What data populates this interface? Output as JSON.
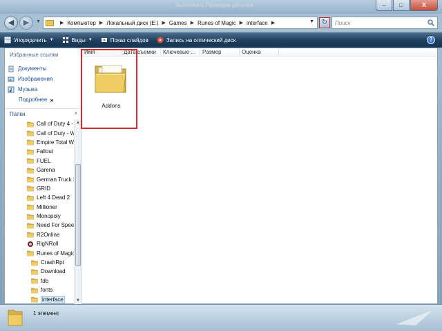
{
  "window": {
    "ghost_title": "Выполнить Проверка деталей"
  },
  "controls": {
    "minimize": "–",
    "maximize": "□",
    "close": "X"
  },
  "breadcrumbs": [
    {
      "label": "Компьютер"
    },
    {
      "label": "Локальный диск (E:)"
    },
    {
      "label": "Games"
    },
    {
      "label": "Runes of Magic"
    },
    {
      "label": "interface"
    }
  ],
  "search": {
    "placeholder": "Поиск"
  },
  "commands": {
    "organize": "Упорядочить",
    "views": "Виды",
    "slideshow": "Показ слайдов",
    "burn": "Запись на оптический диск"
  },
  "favorites": {
    "title": "Избранные ссылки",
    "items": [
      {
        "label": "Документы"
      },
      {
        "label": "Изображения"
      },
      {
        "label": "Музыка"
      }
    ],
    "more": "Подробнее",
    "more_glyph": "»"
  },
  "folders": {
    "title": "Папки",
    "tree": [
      {
        "label": "Call of Duty 4 - ",
        "level": 1
      },
      {
        "label": "Call of Duty - W",
        "level": 1
      },
      {
        "label": "Empire Total W",
        "level": 1
      },
      {
        "label": "Fallout",
        "level": 1
      },
      {
        "label": "FUEL",
        "level": 1
      },
      {
        "label": "Garena",
        "level": 1
      },
      {
        "label": "German Truck S",
        "level": 1
      },
      {
        "label": "GRID",
        "level": 1
      },
      {
        "label": "Left 4 Dead 2",
        "level": 1
      },
      {
        "label": "Millioner",
        "level": 1
      },
      {
        "label": "Monopoly",
        "level": 1
      },
      {
        "label": "Need For Spee",
        "level": 1
      },
      {
        "label": "R2Online",
        "level": 1
      },
      {
        "label": "RigNRoll",
        "level": 1
      },
      {
        "label": "Runes of Magic",
        "level": 1
      },
      {
        "label": "CrashRpt",
        "level": 2
      },
      {
        "label": "Download",
        "level": 2
      },
      {
        "label": "fdb",
        "level": 2
      },
      {
        "label": "fonts",
        "level": 2
      },
      {
        "label": "interface",
        "level": 2
      }
    ]
  },
  "columns": [
    "Имя",
    "Дата съемки",
    "Ключевые ...",
    "Размер",
    "Оценка"
  ],
  "files": [
    {
      "name": "Addons"
    }
  ],
  "status": {
    "text": "1 элемент"
  },
  "colors": {
    "folder": "#e8c65a",
    "selection": "#e3262c",
    "commandbar": "#1f3f5e",
    "link": "#1e4ea0"
  }
}
